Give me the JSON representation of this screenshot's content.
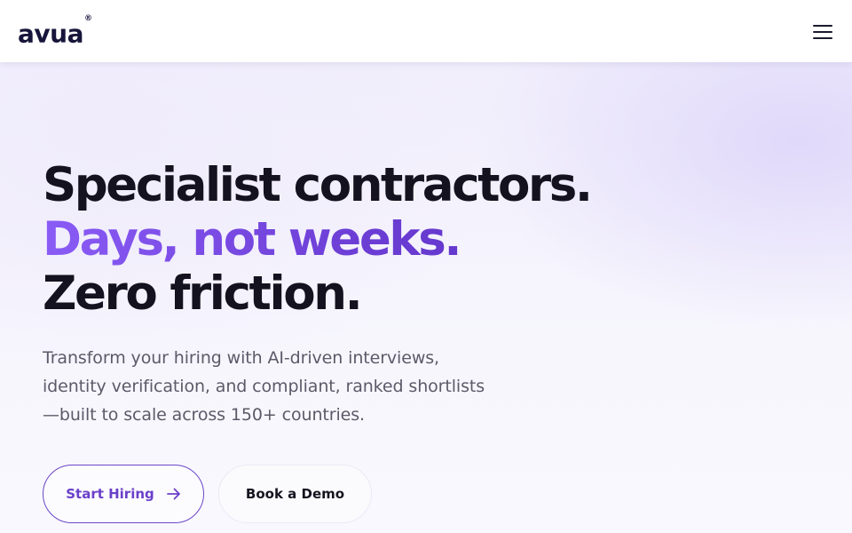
{
  "header": {
    "logo_text": "avua",
    "logo_mark": "®",
    "menu_icon": "hamburger-menu-icon"
  },
  "hero": {
    "headline_line1": "Specialist contractors.",
    "headline_line2": "Days, not weeks.",
    "headline_line3": "Zero friction.",
    "subtext": "Transform your hiring with AI-driven interviews, identity verification, and compliant, ranked shortlists—built to scale across 150+ countries.",
    "primary_button_label": "Start Hiring",
    "primary_button_icon": "arrow-right-icon",
    "secondary_button_label": "Book a Demo"
  },
  "colors": {
    "accent": "#6a40c9",
    "accent_gradient_start": "#8a5cf6",
    "text_dark": "#14121f",
    "text_muted": "#5c5a68",
    "background": "#f6f4fd"
  }
}
